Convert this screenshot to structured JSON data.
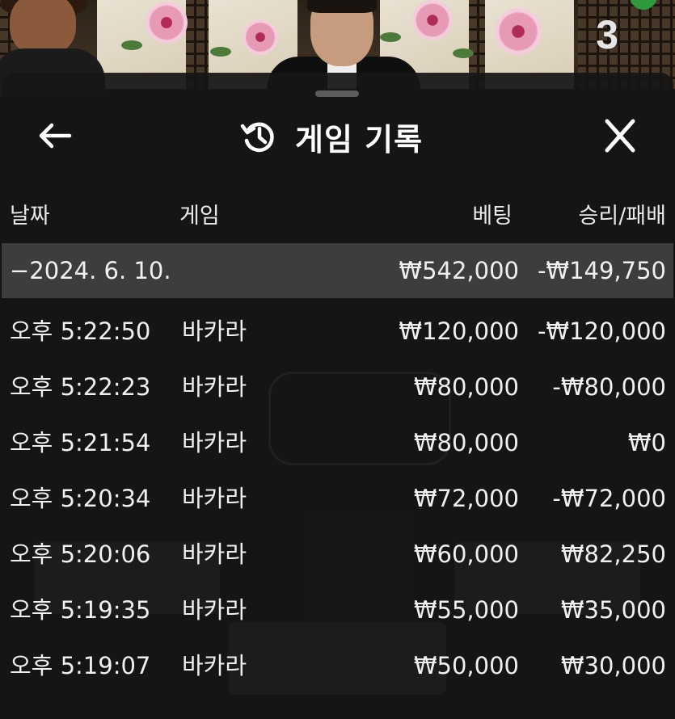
{
  "background": {
    "round_number": "3"
  },
  "sheet": {
    "title": "게임 기록",
    "icons": {
      "back": "arrow-left-icon",
      "history": "history-icon",
      "close": "close-icon"
    },
    "columns": {
      "date": "날짜",
      "game": "게임",
      "bet": "베팅",
      "result": "승리/패배"
    },
    "day_summary": {
      "date": "−2024. 6. 10.",
      "bet": "₩542,000",
      "result": "-₩149,750"
    },
    "rows": [
      {
        "time": "오후 5:22:50",
        "game": "바카라",
        "bet": "₩120,000",
        "result": "-₩120,000"
      },
      {
        "time": "오후 5:22:23",
        "game": "바카라",
        "bet": "₩80,000",
        "result": "-₩80,000"
      },
      {
        "time": "오후 5:21:54",
        "game": "바카라",
        "bet": "₩80,000",
        "result": "₩0"
      },
      {
        "time": "오후 5:20:34",
        "game": "바카라",
        "bet": "₩72,000",
        "result": "-₩72,000"
      },
      {
        "time": "오후 5:20:06",
        "game": "바카라",
        "bet": "₩60,000",
        "result": "₩82,250"
      },
      {
        "time": "오후 5:19:35",
        "game": "바카라",
        "bet": "₩55,000",
        "result": "₩35,000"
      },
      {
        "time": "오후 5:19:07",
        "game": "바카라",
        "bet": "₩50,000",
        "result": "₩30,000"
      }
    ]
  }
}
